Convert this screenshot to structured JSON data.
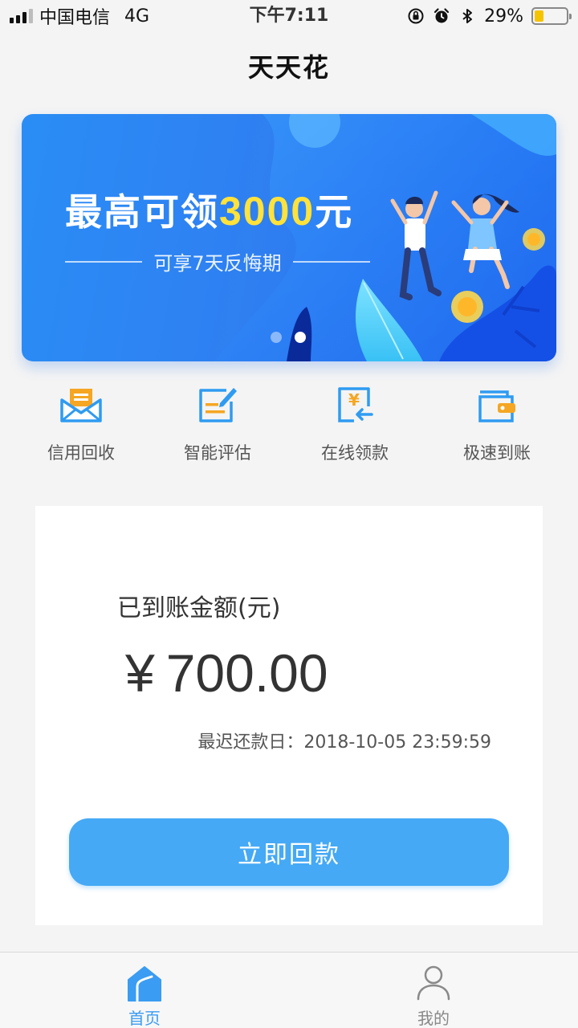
{
  "status_bar": {
    "carrier": "中国电信",
    "network": "4G",
    "time": "下午7:11",
    "battery": "29%",
    "battery_level": 0.29,
    "icons": [
      "signal-icon",
      "orientation-lock-icon",
      "alarm-icon",
      "bluetooth-icon",
      "battery-icon"
    ]
  },
  "nav": {
    "title": "天天花"
  },
  "banner": {
    "headline_pre": "最高可领",
    "headline_amount": "3000",
    "headline_post": "元",
    "subline": "可享7天反悔期",
    "slides": 2,
    "active_slide": 2,
    "colors": {
      "background": "#2f7ff1",
      "highlight": "#ffe23a"
    }
  },
  "features": [
    {
      "label": "信用回收",
      "icon": "envelope-icon"
    },
    {
      "label": "智能评估",
      "icon": "edit-document-icon"
    },
    {
      "label": "在线领款",
      "icon": "yen-document-icon"
    },
    {
      "label": "极速到账",
      "icon": "wallet-icon"
    }
  ],
  "card": {
    "amount_label": "已到账金额(元)",
    "currency": "¥",
    "amount": "700.00",
    "due_label": "最迟还款日：",
    "due_date": "2018-10-05 23:59:59",
    "button_label": "立即回款"
  },
  "tabs": [
    {
      "label": "首页",
      "icon": "home-icon",
      "active": true
    },
    {
      "label": "我的",
      "icon": "user-icon",
      "active": false
    }
  ],
  "colors": {
    "accent": "#45a9f5",
    "icon_blue": "#2f9bf1",
    "icon_orange": "#f5a623"
  }
}
